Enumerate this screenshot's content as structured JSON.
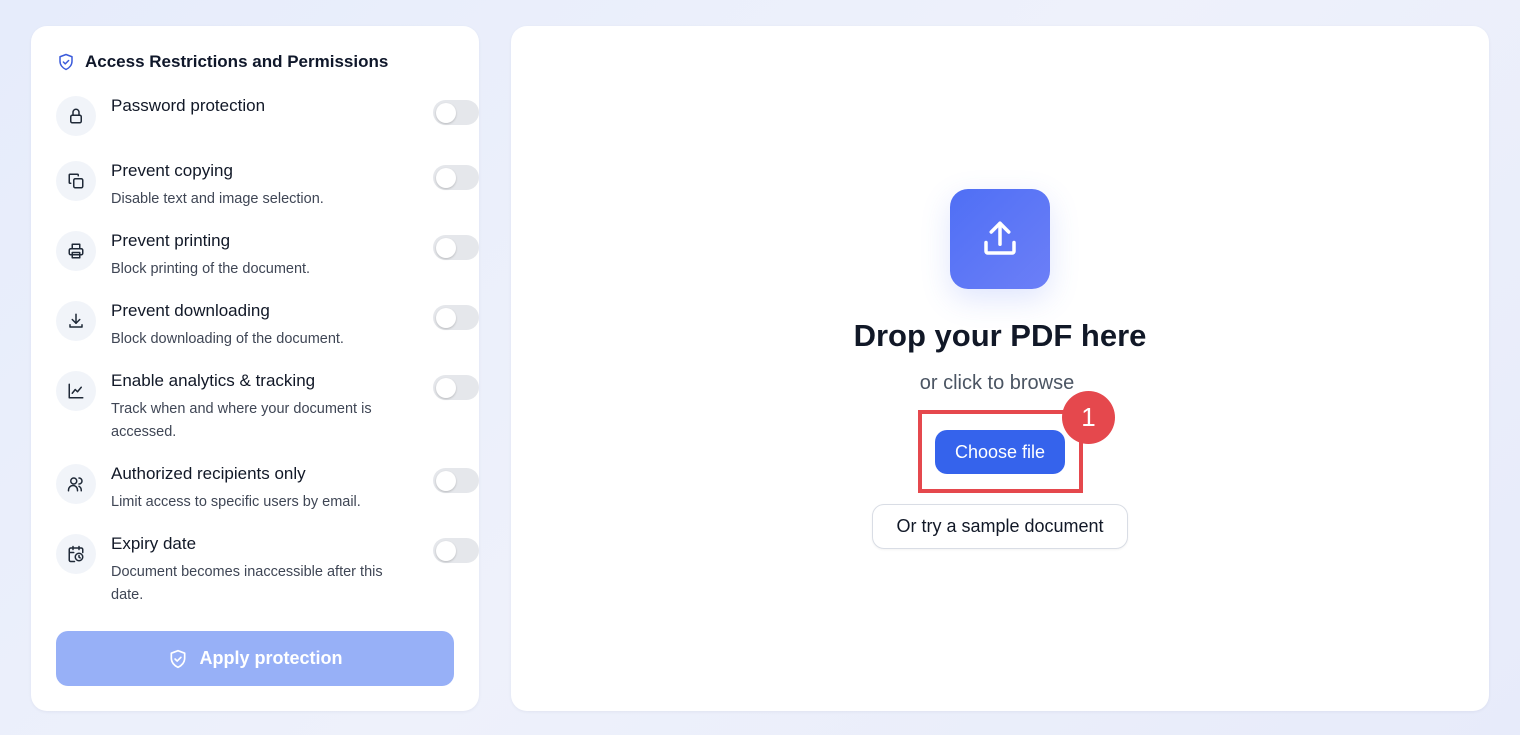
{
  "settings": {
    "title": "Access Restrictions and Permissions",
    "options": [
      {
        "label": "Password protection",
        "desc": "",
        "icon": "lock-icon",
        "enabled": false
      },
      {
        "label": "Prevent copying",
        "desc": "Disable text and image selection.",
        "icon": "copy-icon",
        "enabled": false
      },
      {
        "label": "Prevent printing",
        "desc": "Block printing of the document.",
        "icon": "printer-icon",
        "enabled": false
      },
      {
        "label": "Prevent downloading",
        "desc": "Block downloading of the document.",
        "icon": "download-icon",
        "enabled": false
      },
      {
        "label": "Enable analytics & tracking",
        "desc": "Track when and where your document is accessed.",
        "icon": "chart-icon",
        "enabled": false
      },
      {
        "label": "Authorized recipients only",
        "desc": "Limit access to specific users by email.",
        "icon": "users-icon",
        "enabled": false
      },
      {
        "label": "Expiry date",
        "desc": "Document becomes inaccessible after this date.",
        "icon": "calendar-clock-icon",
        "enabled": false
      }
    ],
    "apply_label": "Apply protection"
  },
  "upload": {
    "title": "Drop your PDF here",
    "subtitle": "or click to browse",
    "choose_label": "Choose file",
    "sample_label": "Or try a sample document",
    "badge": "1"
  },
  "colors": {
    "accent": "#3563ec",
    "apply_disabled": "#97b0f7",
    "highlight": "#e5484d"
  }
}
